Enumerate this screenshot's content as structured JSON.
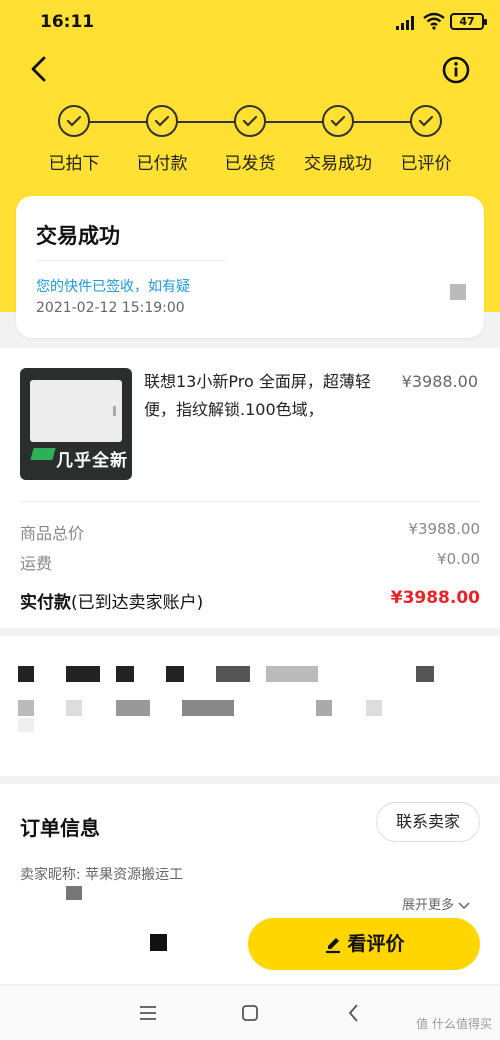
{
  "status_bar": {
    "time": "16:11",
    "battery": "47"
  },
  "steps": [
    {
      "label": "已拍下"
    },
    {
      "label": "已付款"
    },
    {
      "label": "已发货"
    },
    {
      "label": "交易成功"
    },
    {
      "label": "已评价"
    }
  ],
  "status_card": {
    "title": "交易成功",
    "message": "您的快件已签收，如有疑",
    "timestamp": "2021-02-12 15:19:00"
  },
  "product": {
    "title": "联想13小新Pro 全面屏，超薄轻便，指纹解锁.100色域，",
    "price": "¥3988.00",
    "thumb_text": "几乎全新"
  },
  "summary": {
    "goods_total_label": "商品总价",
    "goods_total_value": "¥3988.00",
    "shipping_label": "运费",
    "shipping_value": "¥0.00",
    "paid_label": "实付款",
    "paid_note": "(已到达卖家账户)",
    "paid_value": "¥3988.00"
  },
  "order_info": {
    "title": "订单信息",
    "contact_button": "联系卖家",
    "seller": "卖家昵称: 苹果资源搬运工",
    "expand": "展开更多"
  },
  "actions": {
    "review_button": "看评价"
  },
  "watermark": "值 什么值得买",
  "colors": {
    "brand_yellow": "#ffe033",
    "price_red": "#e8232a",
    "link_blue": "#1e9ad6"
  }
}
